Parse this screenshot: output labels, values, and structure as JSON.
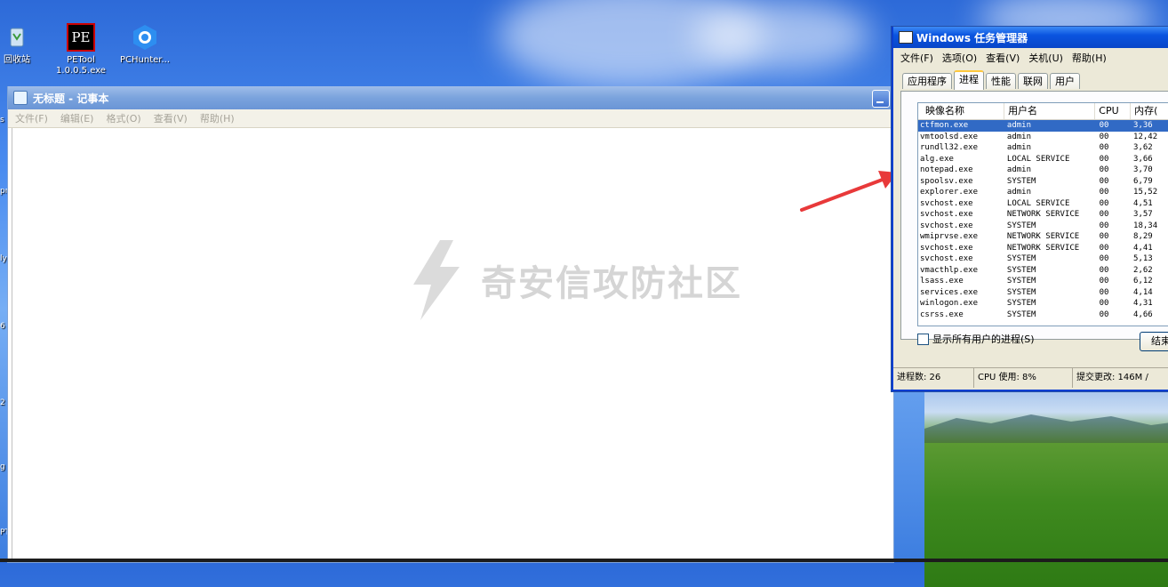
{
  "desktop": {
    "icons": [
      {
        "label": "回收站",
        "name": "recycle-bin-icon"
      },
      {
        "label": "PETool\n1.0.0.5.exe",
        "name": "petool-icon",
        "badge": "PE"
      },
      {
        "label": "PCHunter...",
        "name": "pchunter-icon"
      }
    ],
    "edge_fragments": [
      "s",
      "pr",
      "ly",
      "6",
      "2",
      "g",
      "g",
      "PT"
    ]
  },
  "notepad": {
    "title": "无标题 - 记事本",
    "menu": [
      "文件(F)",
      "编辑(E)",
      "格式(O)",
      "查看(V)",
      "帮助(H)"
    ]
  },
  "taskmgr": {
    "title": "Windows 任务管理器",
    "menu": [
      "文件(F)",
      "选项(O)",
      "查看(V)",
      "关机(U)",
      "帮助(H)"
    ],
    "tabs": [
      "应用程序",
      "进程",
      "性能",
      "联网",
      "用户"
    ],
    "active_tab": "进程",
    "columns": [
      "映像名称",
      "用户名",
      "CPU",
      "内存("
    ],
    "rows": [
      [
        "ctfmon.exe",
        "admin",
        "00",
        "3,36"
      ],
      [
        "vmtoolsd.exe",
        "admin",
        "00",
        "12,42"
      ],
      [
        "rundll32.exe",
        "admin",
        "00",
        "3,62"
      ],
      [
        "alg.exe",
        "LOCAL SERVICE",
        "00",
        "3,66"
      ],
      [
        "notepad.exe",
        "admin",
        "00",
        "3,70"
      ],
      [
        "spoolsv.exe",
        "SYSTEM",
        "00",
        "6,79"
      ],
      [
        "explorer.exe",
        "admin",
        "00",
        "15,52"
      ],
      [
        "svchost.exe",
        "LOCAL SERVICE",
        "00",
        "4,51"
      ],
      [
        "svchost.exe",
        "NETWORK SERVICE",
        "00",
        "3,57"
      ],
      [
        "svchost.exe",
        "SYSTEM",
        "00",
        "18,34"
      ],
      [
        "wmiprvse.exe",
        "NETWORK SERVICE",
        "00",
        "8,29"
      ],
      [
        "svchost.exe",
        "NETWORK SERVICE",
        "00",
        "4,41"
      ],
      [
        "svchost.exe",
        "SYSTEM",
        "00",
        "5,13"
      ],
      [
        "vmacthlp.exe",
        "SYSTEM",
        "00",
        "2,62"
      ],
      [
        "lsass.exe",
        "SYSTEM",
        "00",
        "6,12"
      ],
      [
        "services.exe",
        "SYSTEM",
        "00",
        "4,14"
      ],
      [
        "winlogon.exe",
        "SYSTEM",
        "00",
        "4,31"
      ],
      [
        "csrss.exe",
        "SYSTEM",
        "00",
        "4,66"
      ]
    ],
    "show_all_label": "显示所有用户的进程(S)",
    "end_button": "结束",
    "status": {
      "processes": "进程数: 26",
      "cpu": "CPU 使用: 8%",
      "commit": "提交更改: 146M /"
    }
  },
  "watermark": "奇安信攻防社区",
  "colors": {
    "arrow": "#e8393a",
    "selection": "#316ac5",
    "xp_title": "#0a54e0"
  }
}
